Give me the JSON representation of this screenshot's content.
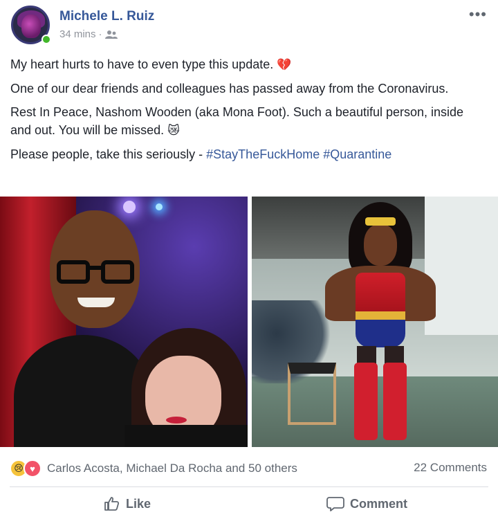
{
  "post": {
    "author": "Michele L. Ruiz",
    "time": "34 mins",
    "separator": "·",
    "audience_icon": "friends-icon",
    "more_icon": "more-options-icon",
    "text": {
      "line1": "My heart hurts to have to even type this update.",
      "line1_emoji": "💔",
      "line2": "One of our dear friends and colleagues has passed away from the Coronavirus.",
      "line3": "Rest In Peace, Nashom Wooden (aka Mona Foot). Such a beautiful person, inside and out. You will be missed.",
      "line3_emoji": "😿",
      "line4": "Please people, take this seriously - ",
      "hashtag1": "#StayTheFuckHome",
      "hashtag2": "#Quarantine"
    }
  },
  "reactions": {
    "icons": [
      "sad-reaction-icon",
      "love-reaction-icon"
    ],
    "sad_glyph": "😢",
    "love_glyph": "♥",
    "summary": "Carlos Acosta, Michael Da Rocha and 50 others",
    "comments": "22 Comments"
  },
  "actions": {
    "like_label": "Like",
    "comment_label": "Comment"
  },
  "colors": {
    "link": "#365899",
    "secondary_text": "#606770",
    "online": "#42b72a"
  }
}
